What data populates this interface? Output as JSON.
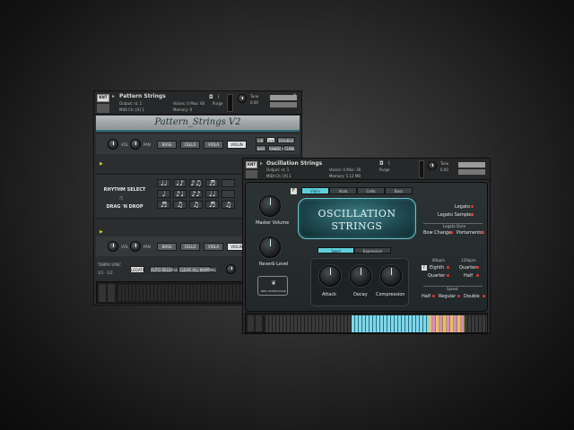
{
  "colors": {
    "accent_teal": "#5fd0da",
    "led_red": "#e33333",
    "panel_dark": "#2a2c2d"
  },
  "pattern_window": {
    "title": "Pattern Strings",
    "output_label": "Output:",
    "output_value": "st. 1",
    "midi_label": "MIDI Ch:",
    "midi_value": "[A] 1",
    "voices_label": "Voices:",
    "voices_value": "0",
    "max_label": "Max:",
    "max_value": "60",
    "memory_label": "Memory:",
    "memory_value": "0",
    "purge_label": "Purge",
    "tune_label": "Tune",
    "tune_value": "0.00",
    "brand_title": "Pattern_Strings V2",
    "vol_label": "VOL",
    "pan_label": "PAN",
    "instruments_top": [
      "BASS",
      "CELLO",
      "VIOLA",
      "VIOLIN"
    ],
    "instruments_bottom": [
      "BASS",
      "CELLO",
      "VIOLA",
      "VIOLIN"
    ],
    "mode_buttons": [
      "1/8",
      "1/4",
      "DOUBLE",
      "BAR",
      "RANDOM",
      "CLINK"
    ],
    "rhythm_select": "RHYTHM SELECT",
    "drag_n_drop": "DRAG 'N DROP",
    "rhythm_notes": [
      "♩♩",
      "♩♪",
      "♪♫",
      "♬",
      "",
      "♩",
      "♪♩",
      "♪♪",
      "♩♩",
      "",
      "♬",
      "♫",
      "♫",
      "♬",
      "♫"
    ],
    "tempo_sync": "TEMPO SYNC",
    "tempo_value": "1/1 · 1/2",
    "bottom_buttons": [
      "LEGATO",
      "AUTO RELEASE",
      "CLEAR ALL MAPPING"
    ]
  },
  "oscillation_window": {
    "title": "Oscillation Strings",
    "output_label": "Output:",
    "output_value": "st. 1",
    "midi_label": "MIDI Ch:",
    "midi_value": "[A] 1",
    "voices_label": "Voices:",
    "voices_value": "0",
    "max_label": "Max:",
    "max_value": "30",
    "memory_label": "Memory:",
    "memory_value": "5.12 MB",
    "purge_label": "Purge",
    "tune_label": "Tune",
    "tune_value": "0.00",
    "tabs": [
      "Violin",
      "Viola",
      "Cello",
      "Bass"
    ],
    "active_tab": "Violin",
    "title_line1": "OSCILLATION",
    "title_line2": "STRINGS",
    "mode_tabs": [
      "Swell",
      "Expression"
    ],
    "active_mode": "Swell",
    "master_volume": "Master Volume",
    "reverb_level": "Reverb Level",
    "brand_name": "BEN OSTERHOUSE",
    "envelope": [
      "Attack",
      "Decay",
      "Compression"
    ],
    "legato": "Legato",
    "legato_samples": "Legato Samples",
    "legato_style": "Legato Style",
    "bow_change": "Bow Change",
    "portamento": "Portamento",
    "bpm_label": "80bpm",
    "eighth": "Eighth",
    "quarter_left": "Quarter",
    "bpm_right_label": "120bpm",
    "quarter_right": "Quarter",
    "half_right": "Half",
    "speed_label": "Speed",
    "speeds": [
      "Half",
      "Regular",
      "Double"
    ]
  }
}
